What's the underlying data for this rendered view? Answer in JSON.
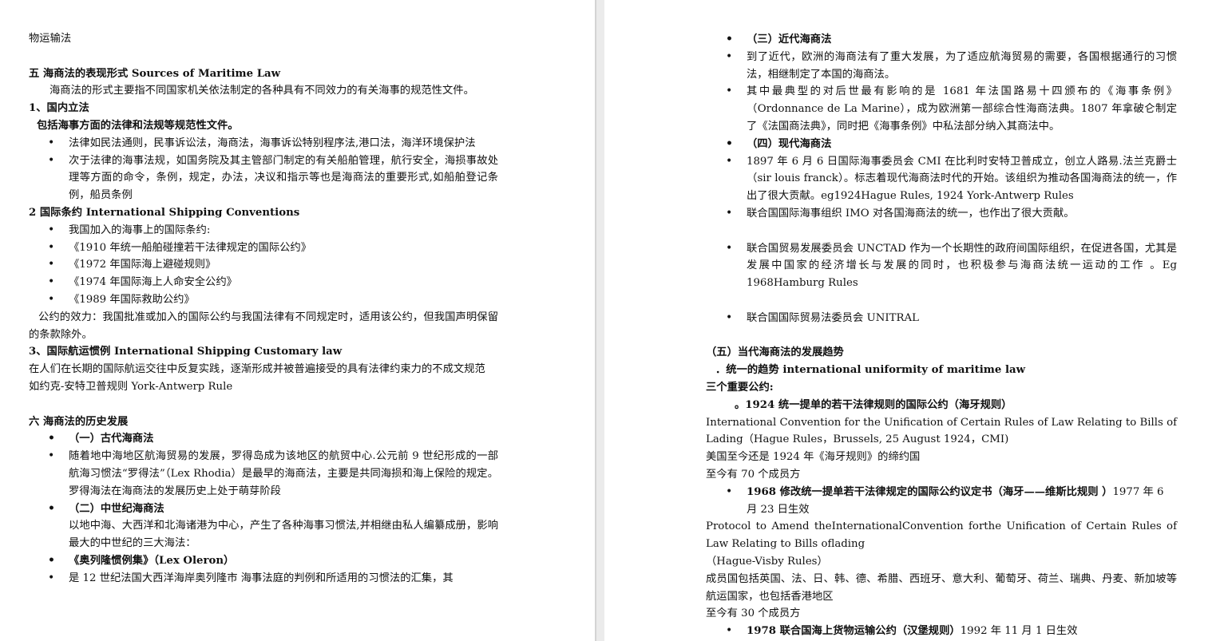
{
  "left_page": {
    "header": "物运输法",
    "s5_title": "五 海商法的表现形式 Sources of Maritime Law",
    "s5_intro": "海商法的形式主要指不同国家机关依法制定的各种具有不同效力的有关海事的规范性文件。",
    "s5_1_title": "1、国内立法",
    "s5_1_sub": "包括海事方面的法律和法规等规范性文件。",
    "s5_1_items": [
      "法律如民法通则，民事诉讼法，海商法，海事诉讼特别程序法,港口法，海洋环境保护法",
      "次于法律的海事法规，如国务院及其主管部门制定的有关船舶管理，航行安全，海损事故处理等方面的命令，条例，规定，办法，决议和指示等也是海商法的重要形式,如船舶登记条例，船员条例"
    ],
    "s5_2_title": "2 国际条约 International Shipping Conventions",
    "s5_2_items": [
      "我国加入的海事上的国际条约:",
      "《1910 年统一船舶碰撞若干法律规定的国际公约》",
      "《1972 年国际海上避碰规则》",
      "《1974 年国际海上人命安全公约》",
      "《1989 年国际救助公约》"
    ],
    "s5_2_effect": "公约的效力：我国批准或加入的国际公约与我国法律有不同规定时，适用该公约，但我国声明保留的条款除外。",
    "s5_3_title": "3、国际航运惯例 International Shipping Customary law",
    "s5_3_text": "在人们在长期的国际航运交往中反复实践，逐渐形成并被普遍接受的具有法律约束力的不成文规范",
    "s5_3_example": "如约克-安特卫普规则 York-Antwerp Rule",
    "s6_title": "六 海商法的历史发展",
    "s6_items": [
      {
        "text": "（一）古代海商法",
        "bold": true
      },
      {
        "text": "随着地中海地区航海贸易的发展，罗得岛成为该地区的航贸中心.公元前 9 世纪形成的一部航海习惯法“罗得法”（Lex Rhodia）是最早的海商法，主要是共同海损和海上保险的规定。罗得海法在海商法的发展历史上处于萌芽阶段",
        "bold": false
      },
      {
        "text": "（二）中世纪海商法",
        "bold": true
      }
    ],
    "s6_medieval_text": "以地中海、大西洋和北海诸港为中心，产生了各种海事习惯法,并相继由私人编纂成册，影响最大的中世纪的三大海法：",
    "s6_items2": [
      {
        "text": "《奥列隆惯例集》（Lex Oleron）",
        "bold": true
      },
      {
        "text": "是 12 世纪法国大西洋海岸奥列隆市 海事法庭的判例和所适用的习惯法的汇集，其",
        "bold": false
      }
    ]
  },
  "right_page": {
    "items_a": [
      {
        "text": "（三）近代海商法",
        "bold": true
      },
      {
        "text": "到了近代，欧洲的海商法有了重大发展，为了适应航海贸易的需要，各国根据通行的习惯法，相继制定了本国的海商法。",
        "bold": false
      },
      {
        "text": "其中最典型的对后世最有影响的是 1681 年法国路易十四颁布的《海事条例》（Ordonnance de La Marine），成为欧洲第一部综合性海商法典。1807 年拿破仑制定了《法国商法典》，同时把《海事条例》中私法部分纳入其商法中。",
        "bold": false
      },
      {
        "text": "（四）现代海商法",
        "bold": true
      },
      {
        "text": "1897 年 6 月 6 日国际海事委员会 CMI 在比利时安特卫普成立，创立人路易.法兰克爵士（sir louis franck）。标志着现代海商法时代的开始。该组织为推动各国海商法的统一，作出了很大贡献。eg1924Hague Rules, 1924 York-Antwerp Rules",
        "bold": false
      },
      {
        "text": "联合国国际海事组织 IMO 对各国海商法的统一，也作出了很大贡献。",
        "bold": false
      }
    ],
    "item_unctad": "联合国贸易发展委员会 UNCTAD 作为一个长期性的政府间国际组织，在促进各国，尤其是发展中国家的经济增长与发展的同时，也积极参与海商法统一运动的工作 。Eg 1968Hamburg Rules",
    "item_unitral": "联合国国际贸易法委员会 UNITRAL",
    "s5_title": "（五）当代海商法的发展趋势",
    "trend": "．统一的趋势 international uniformity of maritime law",
    "three": "三个重要公约:",
    "hague_title": "。1924 统一提单的若干法律规则的国际公约（海牙规则）",
    "hague_en": "International Convention for the Unification of Certain Rules of Law Relating to Bills of Lading（Hague Rules，Brussels, 25 August 1924，CMI)",
    "hague_us": "美国至今还是 1924 年《海牙规则》的缔约国",
    "hague_members": "至今有 70 个成员方",
    "visby_title": "1968 修改统一提单若干法律规定的国际公约议定书（海牙——维斯比规则 ）",
    "visby_date": "1977 年 6 月 23 日生效",
    "visby_en": "Protocol to Amend theInternationalConvention forthe Unification of Certain Rules of Law Relating to Bills oflading",
    "visby_short": "（Hague-Visby Rules）",
    "visby_members_list": "成员国包括英国、法、日、韩、德、希腊、西班牙、意大利、葡萄牙、荷兰、瑞典、丹麦、新加坡等航运国家，也包括香港地区",
    "visby_members": "至今有 30 个成员方",
    "hamburg_title": "1978 联合国海上货物运输公约（汉堡规则）",
    "hamburg_date": "1992 年 11 月 1 日生效"
  }
}
